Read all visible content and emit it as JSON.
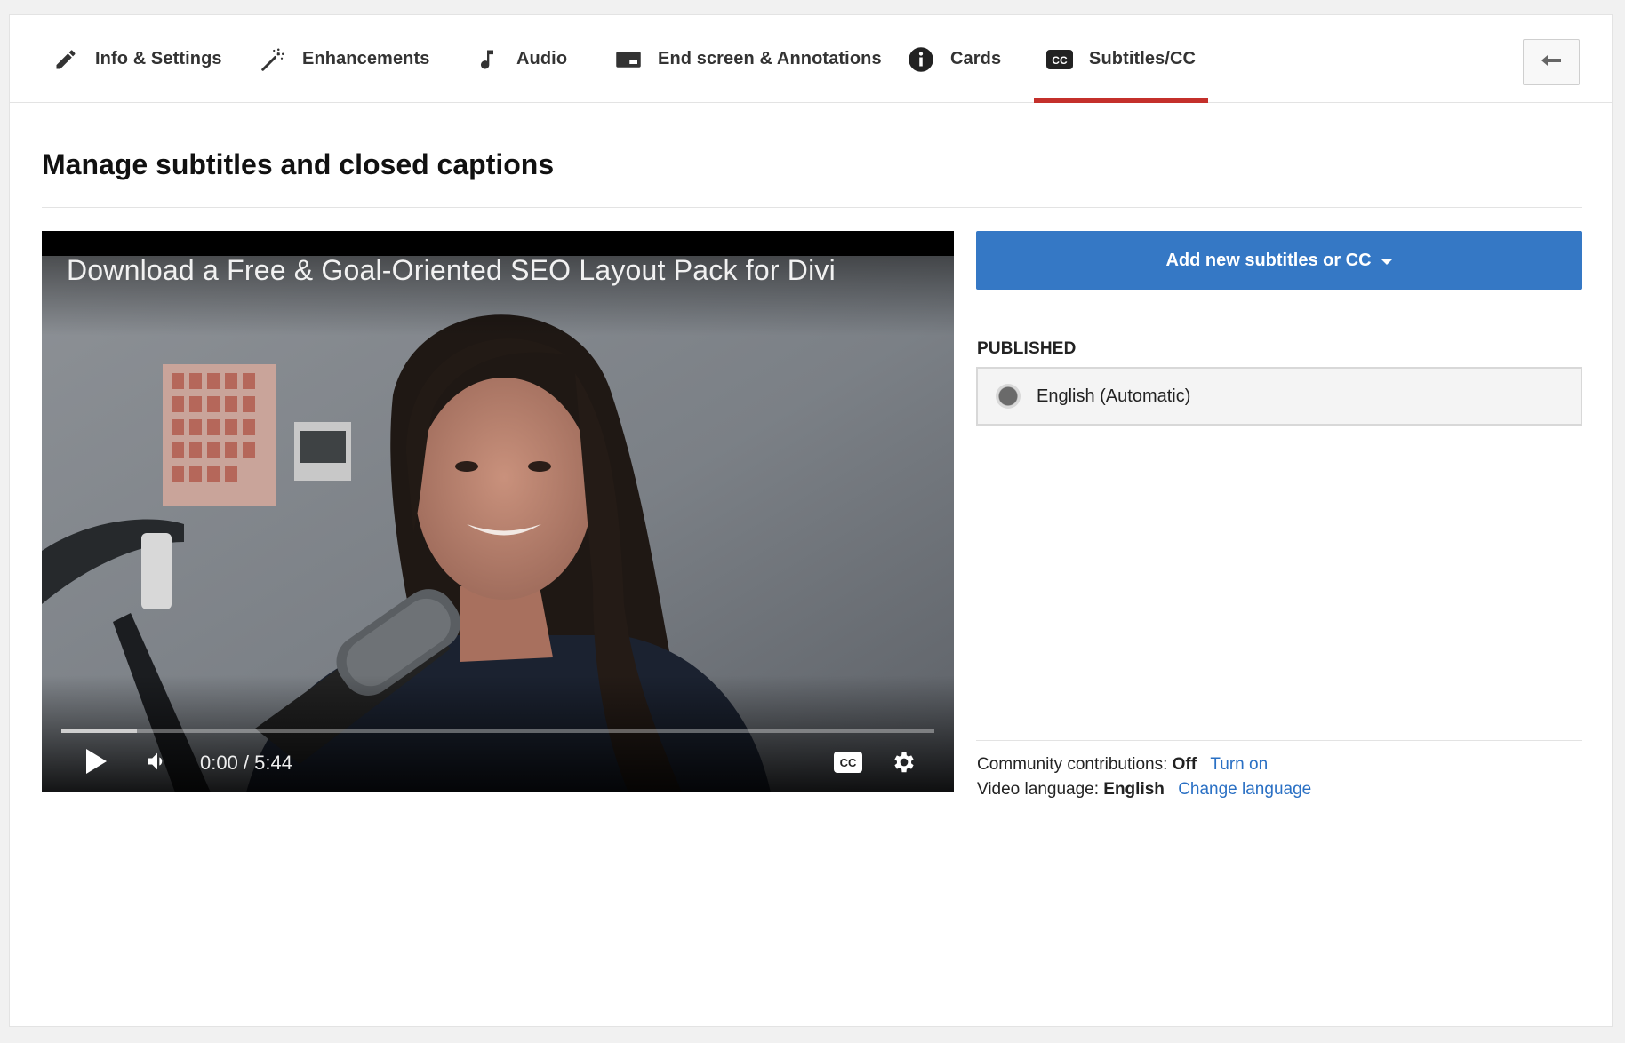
{
  "tabs": [
    {
      "label": "Info & Settings",
      "icon": "pencil-icon",
      "active": false
    },
    {
      "label": "Enhancements",
      "icon": "magic-wand-icon",
      "active": false
    },
    {
      "label": "Audio",
      "icon": "music-note-icon",
      "active": false
    },
    {
      "label": "End screen & Annotations",
      "icon": "end-screen-icon",
      "active": false
    },
    {
      "label": "Cards",
      "icon": "info-icon",
      "active": false
    },
    {
      "label": "Subtitles/CC",
      "icon": "cc-icon",
      "active": true
    }
  ],
  "back_button": {
    "icon": "back-arrow-icon"
  },
  "page_title": "Manage subtitles and closed captions",
  "video": {
    "title": "Download a Free & Goal-Oriented SEO Layout Pack for Divi",
    "time": "0:00 / 5:44",
    "progress_buffered": 0.087,
    "controls": [
      "play-icon",
      "volume-icon",
      "cc-icon",
      "settings-icon"
    ]
  },
  "add_button": {
    "label": "Add new subtitles or CC",
    "icon": "caret-down-icon"
  },
  "published": {
    "label": "PUBLISHED",
    "items": [
      {
        "name": "English (Automatic)"
      }
    ]
  },
  "community": {
    "label": "Community contributions:",
    "value": "Off",
    "link": "Turn on"
  },
  "video_language": {
    "label": "Video language:",
    "value": "English",
    "link": "Change language"
  },
  "colors": {
    "accent_red": "#c4302b",
    "button_blue": "#3578c5",
    "link_blue": "#2a70c4"
  }
}
